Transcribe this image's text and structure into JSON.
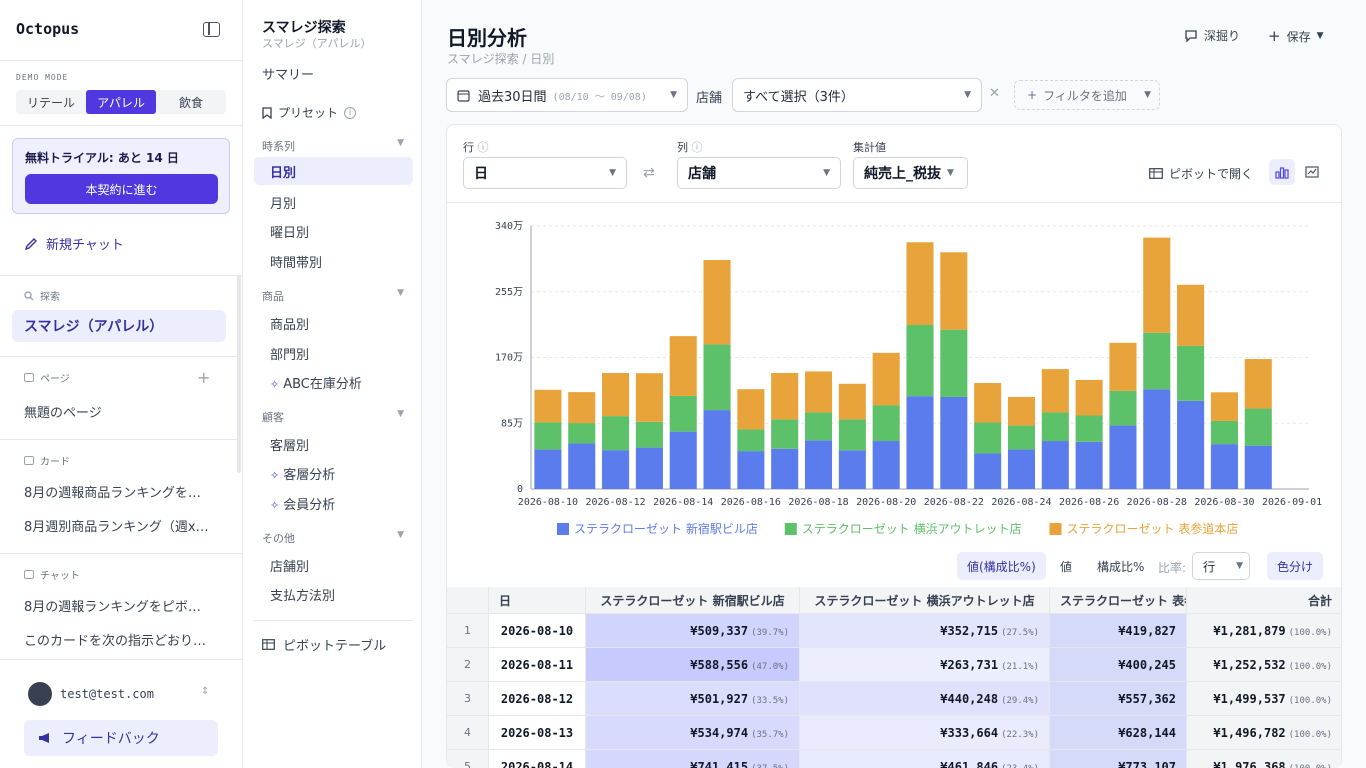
{
  "app": {
    "brand": "Octopus",
    "demo_mode": "DEMO MODE",
    "modes": [
      "リテール",
      "アパレル",
      "飲食"
    ],
    "active_mode": 1
  },
  "trial": {
    "text": "無料トライアル: あと 14 日",
    "button": "本契約に進む"
  },
  "sidebar": {
    "new_chat": "新規チャット",
    "explore_label": "探索",
    "explore_item": "スマレジ（アパレル）",
    "pages_label": "ページ",
    "pages": [
      "無題のページ"
    ],
    "cards_label": "カード",
    "cards": [
      "8月の週報商品ランキングを…",
      "8月週別商品ランキング（週x…"
    ],
    "chats_label": "チャット",
    "chats": [
      "8月の週報ランキングをピボ…",
      "このカードを次の指示どおり…"
    ],
    "user": "test@test.com",
    "feedback": "フィードバック"
  },
  "nav": {
    "title": "スマレジ探索",
    "subtitle": "スマレジ（アパレル）",
    "summary": "サマリー",
    "preset": "プリセット",
    "groups": [
      {
        "label": "時系列",
        "items": [
          "日別",
          "月別",
          "曜日別",
          "時間帯別"
        ]
      },
      {
        "label": "商品",
        "items": [
          "商品別",
          "部門別",
          "ABC在庫分析"
        ]
      },
      {
        "label": "顧客",
        "items": [
          "客層別",
          "客層分析",
          "会員分析"
        ]
      },
      {
        "label": "その他",
        "items": [
          "店舗別",
          "支払方法別"
        ]
      }
    ],
    "pivot": "ピボットテーブル"
  },
  "main": {
    "title": "日別分析",
    "breadcrumb": "スマレジ探索 / 日別",
    "drill": "深掘り",
    "save": "保存",
    "period": "過去30日間",
    "period_range": "(08/10 〜 09/08)",
    "store_label": "店舗",
    "store_value": "すべて選択（3件）",
    "add_filter": "フィルタを追加",
    "row_label": "行",
    "row_value": "日",
    "col_label": "列",
    "col_value": "店舗",
    "agg_label": "集計値",
    "agg_value": "純売上_税抜",
    "open_pivot": "ピボットで開く",
    "toggles": [
      "値(構成比%)",
      "値",
      "構成比%"
    ],
    "ratio_label": "比率:",
    "ratio_value": "行",
    "color_btn": "色分け"
  },
  "chart_data": {
    "type": "bar",
    "stacked": true,
    "ytick_labels": [
      "0",
      "85万",
      "170万",
      "255万",
      "340万"
    ],
    "ylim": [
      0,
      3400000
    ],
    "colors": [
      "#5b7cec",
      "#5cc168",
      "#e8a33a"
    ],
    "categories": [
      "2026-08-10",
      "2026-08-11",
      "2026-08-12",
      "2026-08-13",
      "2026-08-14",
      "2026-08-15",
      "2026-08-16",
      "2026-08-17",
      "2026-08-18",
      "2026-08-19",
      "2026-08-20",
      "2026-08-21",
      "2026-08-22",
      "2026-08-23",
      "2026-08-24",
      "2026-08-25",
      "2026-08-26",
      "2026-08-27",
      "2026-08-28",
      "2026-08-29",
      "2026-08-30",
      "2026-08-31",
      "2026-09-01"
    ],
    "xtick_labels": [
      "2026-08-10",
      "2026-08-12",
      "2026-08-14",
      "2026-08-16",
      "2026-08-18",
      "2026-08-20",
      "2026-08-22",
      "2026-08-24",
      "2026-08-26",
      "2026-08-28",
      "2026-08-30",
      "2026-09-01"
    ],
    "series": [
      {
        "name": "ステラクローゼット 新宿駅ビル店",
        "values": [
          509337,
          588556,
          501927,
          534974,
          741415,
          1020000,
          490000,
          520000,
          630000,
          500000,
          620000,
          1200000,
          1190000,
          460000,
          510000,
          620000,
          610000,
          820000,
          1290000,
          1140000,
          580000,
          560000,
          0
        ]
      },
      {
        "name": "ステラクローゼット 横浜アウトレット店",
        "values": [
          352715,
          263731,
          440248,
          333664,
          461846,
          850000,
          280000,
          380000,
          360000,
          400000,
          460000,
          920000,
          870000,
          400000,
          310000,
          370000,
          340000,
          450000,
          730000,
          710000,
          300000,
          480000,
          0
        ]
      },
      {
        "name": "ステラクローゼット 表参道本店",
        "values": [
          419827,
          400245,
          557362,
          628144,
          773107,
          1090000,
          520000,
          600000,
          530000,
          460000,
          680000,
          1070000,
          1000000,
          510000,
          370000,
          560000,
          460000,
          620000,
          1230000,
          790000,
          370000,
          640000,
          0
        ]
      }
    ]
  },
  "table": {
    "headers": [
      "日",
      "ステラクローゼット 新宿駅ビル店",
      "ステラクローゼット 横浜アウトレット店",
      "ステラクローゼット 表参道本店",
      "合計"
    ],
    "rows": [
      {
        "n": "1",
        "d": "2026-08-10",
        "a": "¥509,337",
        "ap": "(39.7%)",
        "b": "¥352,715",
        "bp": "(27.5%)",
        "c": "¥419,827",
        "t": "¥1,281,879",
        "tp": "(100.0%)"
      },
      {
        "n": "2",
        "d": "2026-08-11",
        "a": "¥588,556",
        "ap": "(47.0%)",
        "b": "¥263,731",
        "bp": "(21.1%)",
        "c": "¥400,245",
        "t": "¥1,252,532",
        "tp": "(100.0%)"
      },
      {
        "n": "3",
        "d": "2026-08-12",
        "a": "¥501,927",
        "ap": "(33.5%)",
        "b": "¥440,248",
        "bp": "(29.4%)",
        "c": "¥557,362",
        "t": "¥1,499,537",
        "tp": "(100.0%)"
      },
      {
        "n": "4",
        "d": "2026-08-13",
        "a": "¥534,974",
        "ap": "(35.7%)",
        "b": "¥333,664",
        "bp": "(22.3%)",
        "c": "¥628,144",
        "t": "¥1,496,782",
        "tp": "(100.0%)"
      },
      {
        "n": "5",
        "d": "2026-08-14",
        "a": "¥741,415",
        "ap": "(37.5%)",
        "b": "¥461,846",
        "bp": "(23.4%)",
        "c": "¥773,107",
        "t": "¥1,976,368",
        "tp": "(100.0%)"
      }
    ]
  }
}
